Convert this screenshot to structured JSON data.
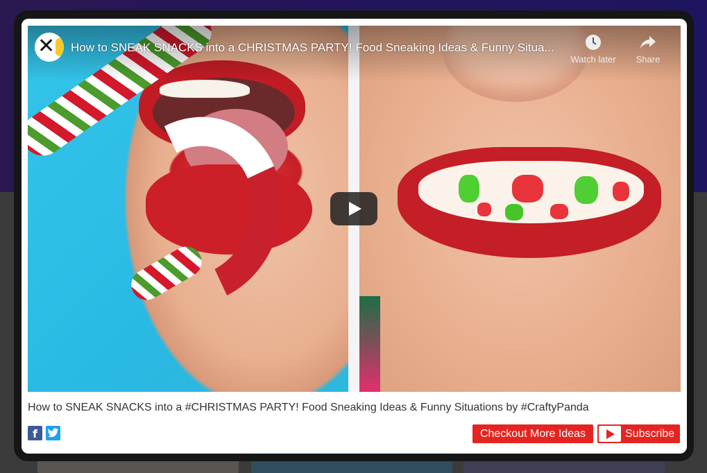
{
  "video": {
    "title": "How to SNEAK SNACKS into a CHRISTMAS PARTY! Food Sneaking Ideas & Funny Situa...",
    "watch_later_label": "Watch later",
    "share_label": "Share",
    "watch_later_icon": "clock-icon",
    "share_icon": "share-arrow-icon",
    "play_icon": "play-icon"
  },
  "caption": "How to SNEAK SNACKS into a #CHRISTMAS PARTY! Food Sneaking Ideas & Funny Situations by #CraftyPanda",
  "social": {
    "facebook_glyph": "f",
    "twitter_glyph": "t"
  },
  "buttons": {
    "checkout_label": "Checkout More Ideas",
    "subscribe_label": "Subscribe"
  },
  "colors": {
    "accent": "#e52421",
    "facebook": "#3b5998",
    "twitter": "#1da1f2"
  }
}
